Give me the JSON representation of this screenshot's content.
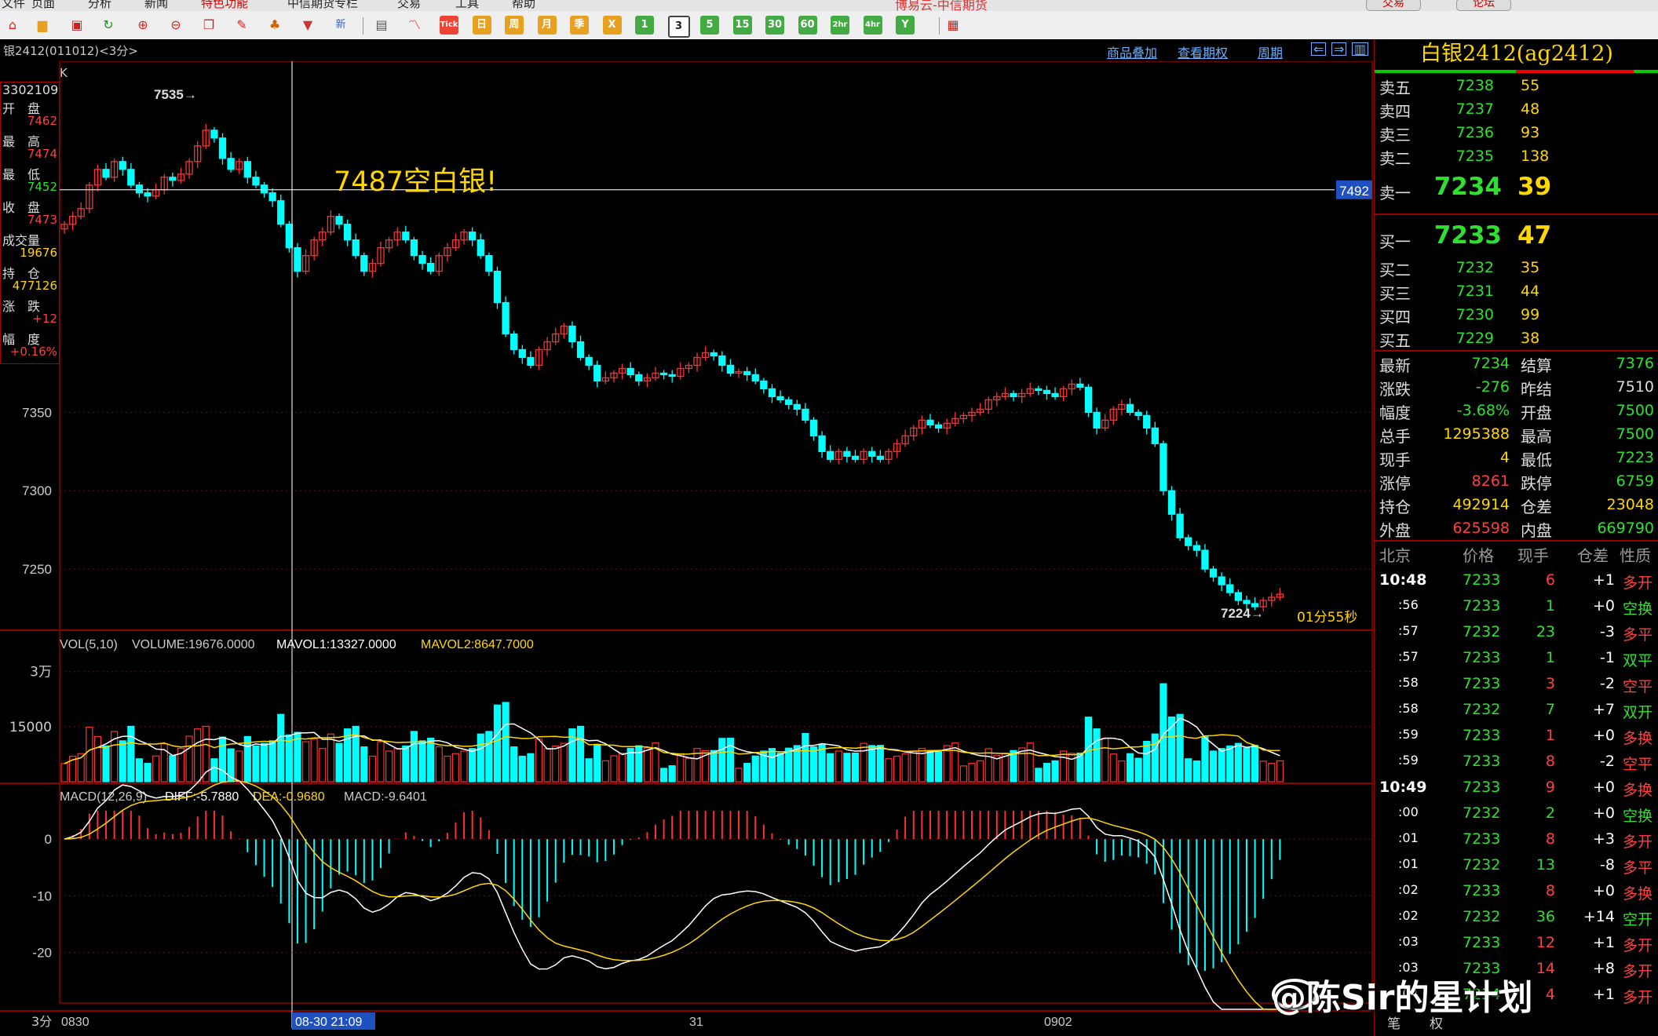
{
  "menubar": {
    "items": [
      "文件",
      "页面",
      "分析",
      "新闻",
      "特色功能",
      "中信期货专栏",
      "交易",
      "工具",
      "帮助"
    ],
    "center_title": "博易云-中信期货",
    "buttons": [
      "交易",
      "论坛"
    ]
  },
  "toolbar": {
    "icons": [
      "home-icon",
      "folder-icon",
      "layout-icon",
      "refresh-icon",
      "zoom-in-icon",
      "zoom-out-icon",
      "window-icon",
      "pencil-icon",
      "brush-icon",
      "filter-icon",
      "new-icon"
    ],
    "period_buttons": [
      "Tick",
      "日",
      "周",
      "月",
      "季",
      "X",
      "1",
      "3",
      "5",
      "15",
      "30",
      "60",
      "2hr",
      "4hr",
      "Y"
    ],
    "active_period": "3",
    "icon_colors": {
      "home": "#d22",
      "folder": "#e8a020",
      "layout": "#c22",
      "refresh": "#2a8a2a",
      "zoom": "#d22",
      "pencil": "#c22",
      "filter": "#c33",
      "new": "#36c"
    }
  },
  "chart_header": {
    "contract": "银2412(011012)<3分>",
    "links": [
      "商品叠加",
      "查看期权",
      "周期"
    ]
  },
  "info_panel": {
    "code": "3302109",
    "rows": [
      {
        "label": "开　盘",
        "value": "7462",
        "color": "#ff4040"
      },
      {
        "label": "最　高",
        "value": "7474",
        "color": "#ff4040"
      },
      {
        "label": "最　低",
        "value": "7452",
        "color": "#30e030"
      },
      {
        "label": "收　盘",
        "value": "7473",
        "color": "#ff4040"
      },
      {
        "label": "成交量",
        "value": "19676",
        "color": "#ffd700"
      },
      {
        "label": "持　仓",
        "value": "477126",
        "color": "#ffd700"
      },
      {
        "label": "涨　跌",
        "value": "+12",
        "color": "#ff4040"
      },
      {
        "label": "幅　度",
        "value": "+0.16%",
        "color": "#ff4040"
      }
    ]
  },
  "chart_data": {
    "type": "candlestick",
    "k_label": "K",
    "y_ticks": [
      7350,
      7300,
      7250
    ],
    "ylim": [
      7211,
      7574
    ],
    "x_labels": [
      "0830",
      "08-30 21:09",
      "31",
      "0902"
    ],
    "period_label": "3分",
    "annotations": {
      "high": "7535",
      "low": "7224",
      "short_signal": "7487空白银!",
      "crosshair_price": "7492",
      "countdown": "01分55秒"
    },
    "close_path": [
      7470,
      7475,
      7480,
      7495,
      7505,
      7500,
      7510,
      7505,
      7495,
      7490,
      7488,
      7492,
      7500,
      7498,
      7502,
      7510,
      7520,
      7530,
      7525,
      7512,
      7505,
      7510,
      7500,
      7495,
      7490,
      7485,
      7470,
      7455,
      7440,
      7450,
      7460,
      7465,
      7475,
      7470,
      7460,
      7450,
      7440,
      7445,
      7455,
      7460,
      7465,
      7460,
      7450,
      7445,
      7440,
      7450,
      7455,
      7460,
      7465,
      7460,
      7450,
      7440,
      7420,
      7400,
      7390,
      7385,
      7380,
      7390,
      7395,
      7400,
      7405,
      7395,
      7385,
      7380,
      7370,
      7372,
      7375,
      7378,
      7374,
      7370,
      7372,
      7375,
      7374,
      7373,
      7378,
      7380,
      7385,
      7388,
      7386,
      7380,
      7375,
      7376,
      7374,
      7370,
      7365,
      7360,
      7358,
      7355,
      7352,
      7345,
      7335,
      7325,
      7320,
      7325,
      7322,
      7320,
      7325,
      7322,
      7320,
      7325,
      7330,
      7335,
      7340,
      7345,
      7342,
      7340,
      7343,
      7346,
      7348,
      7350,
      7352,
      7358,
      7360,
      7362,
      7360,
      7362,
      7365,
      7364,
      7362,
      7360,
      7365,
      7368,
      7366,
      7350,
      7340,
      7345,
      7352,
      7355,
      7350,
      7348,
      7340,
      7330,
      7300,
      7285,
      7270,
      7265,
      7262,
      7250,
      7245,
      7240,
      7235,
      7230,
      7228,
      7226,
      7230,
      7232,
      7234
    ],
    "volume": {
      "label": "VOL(5,10)",
      "volume": "VOLUME:19676.0000",
      "mavol1": "MAVOL1:13327.0000",
      "mavol2": "MAVOL2:8647.7000",
      "y_ticks": [
        "3万",
        "15000"
      ],
      "ylim": [
        0,
        37000
      ]
    },
    "macd": {
      "label": "MACD(12,26,9)",
      "diff": "DIFF:-5.7880",
      "dea": "DEA:-0.9680",
      "macd": "MACD:-9.6401",
      "y_ticks": [
        "0",
        "-10",
        "-20"
      ],
      "ylim": [
        -30,
        5
      ]
    },
    "colors": {
      "up": "#ff3030",
      "down": "#00ffff",
      "ma1": "#ffffff",
      "ma2": "#ffd700",
      "grid": "#8b0000"
    }
  },
  "quote": {
    "title": "白银2412(ag2412)",
    "asks": [
      {
        "label": "卖五",
        "price": "7238",
        "vol": "55"
      },
      {
        "label": "卖四",
        "price": "7237",
        "vol": "48"
      },
      {
        "label": "卖三",
        "price": "7236",
        "vol": "93"
      },
      {
        "label": "卖二",
        "price": "7235",
        "vol": "138"
      }
    ],
    "ask1": {
      "label": "卖一",
      "price": "7234",
      "vol": "39"
    },
    "bid1": {
      "label": "买一",
      "price": "7233",
      "vol": "47"
    },
    "bids": [
      {
        "label": "买二",
        "price": "7232",
        "vol": "35"
      },
      {
        "label": "买三",
        "price": "7231",
        "vol": "44"
      },
      {
        "label": "买四",
        "price": "7230",
        "vol": "99"
      },
      {
        "label": "买五",
        "price": "7229",
        "vol": "38"
      }
    ],
    "stats": [
      [
        {
          "label": "最新",
          "value": "7234",
          "color": "#30e030"
        },
        {
          "label": "结算",
          "value": "7376",
          "color": "#30e030"
        }
      ],
      [
        {
          "label": "涨跌",
          "value": "-276",
          "color": "#30e030"
        },
        {
          "label": "昨结",
          "value": "7510",
          "color": "#ddd"
        }
      ],
      [
        {
          "label": "幅度",
          "value": "-3.68%",
          "color": "#30e030"
        },
        {
          "label": "开盘",
          "value": "7500",
          "color": "#30e030"
        }
      ],
      [
        {
          "label": "总手",
          "value": "1295388",
          "color": "#ffd700"
        },
        {
          "label": "最高",
          "value": "7500",
          "color": "#30e030"
        }
      ],
      [
        {
          "label": "现手",
          "value": "4",
          "color": "#ffd700"
        },
        {
          "label": "最低",
          "value": "7223",
          "color": "#30e030"
        }
      ],
      [
        {
          "label": "涨停",
          "value": "8261",
          "color": "#ff4040"
        },
        {
          "label": "跌停",
          "value": "6759",
          "color": "#30e030"
        }
      ],
      [
        {
          "label": "持仓",
          "value": "492914",
          "color": "#ffd700"
        },
        {
          "label": "仓差",
          "value": "23048",
          "color": "#ffd700"
        }
      ],
      [
        {
          "label": "外盘",
          "value": "625598",
          "color": "#ff4040"
        },
        {
          "label": "内盘",
          "value": "669790",
          "color": "#30e030"
        }
      ]
    ],
    "tick_headers": [
      "北京",
      "价格",
      "现手",
      "仓差",
      "性质"
    ],
    "ticks": [
      {
        "time": "10:48",
        "price": "7233",
        "vol": "6",
        "oi": "+1",
        "nature": "多开",
        "ncolor": "#ff4040",
        "vcolor": "#ff4040"
      },
      {
        "time": ":56",
        "price": "7233",
        "vol": "1",
        "oi": "+0",
        "nature": "空换",
        "ncolor": "#30e030",
        "vcolor": "#30e030"
      },
      {
        "time": ":57",
        "price": "7232",
        "vol": "23",
        "oi": "-3",
        "nature": "多平",
        "ncolor": "#ff4040",
        "vcolor": "#30e030"
      },
      {
        "time": ":57",
        "price": "7233",
        "vol": "1",
        "oi": "-1",
        "nature": "双平",
        "ncolor": "#30e030",
        "vcolor": "#30e030"
      },
      {
        "time": ":58",
        "price": "7233",
        "vol": "3",
        "oi": "-2",
        "nature": "空平",
        "ncolor": "#ff4040",
        "vcolor": "#ff4040"
      },
      {
        "time": ":58",
        "price": "7232",
        "vol": "7",
        "oi": "+7",
        "nature": "双开",
        "ncolor": "#30e030",
        "vcolor": "#30e030"
      },
      {
        "time": ":59",
        "price": "7233",
        "vol": "1",
        "oi": "+0",
        "nature": "多换",
        "ncolor": "#ff4040",
        "vcolor": "#ff4040"
      },
      {
        "time": ":59",
        "price": "7233",
        "vol": "8",
        "oi": "-2",
        "nature": "空平",
        "ncolor": "#ff4040",
        "vcolor": "#ff4040"
      },
      {
        "time": "10:49",
        "price": "7233",
        "vol": "9",
        "oi": "+0",
        "nature": "多换",
        "ncolor": "#ff4040",
        "vcolor": "#ff4040"
      },
      {
        "time": ":00",
        "price": "7232",
        "vol": "2",
        "oi": "+0",
        "nature": "空换",
        "ncolor": "#30e030",
        "vcolor": "#30e030"
      },
      {
        "time": ":01",
        "price": "7233",
        "vol": "8",
        "oi": "+3",
        "nature": "多开",
        "ncolor": "#ff4040",
        "vcolor": "#ff4040"
      },
      {
        "time": ":01",
        "price": "7232",
        "vol": "13",
        "oi": "-8",
        "nature": "多平",
        "ncolor": "#ff4040",
        "vcolor": "#30e030"
      },
      {
        "time": ":02",
        "price": "7233",
        "vol": "8",
        "oi": "+0",
        "nature": "多换",
        "ncolor": "#ff4040",
        "vcolor": "#ff4040"
      },
      {
        "time": ":02",
        "price": "7232",
        "vol": "36",
        "oi": "+14",
        "nature": "空开",
        "ncolor": "#30e030",
        "vcolor": "#30e030"
      },
      {
        "time": ":03",
        "price": "7233",
        "vol": "12",
        "oi": "+1",
        "nature": "多开",
        "ncolor": "#ff4040",
        "vcolor": "#ff4040"
      },
      {
        "time": ":03",
        "price": "7233",
        "vol": "14",
        "oi": "+8",
        "nature": "多开",
        "ncolor": "#ff4040",
        "vcolor": "#ff4040"
      },
      {
        "time": ":04",
        "price": "7234",
        "vol": "4",
        "oi": "+1",
        "nature": "多开",
        "ncolor": "#ff4040",
        "vcolor": "#ff4040"
      }
    ],
    "bottom_tabs": [
      "笔",
      "权"
    ]
  },
  "watermark": "@陈Sir的星计划"
}
